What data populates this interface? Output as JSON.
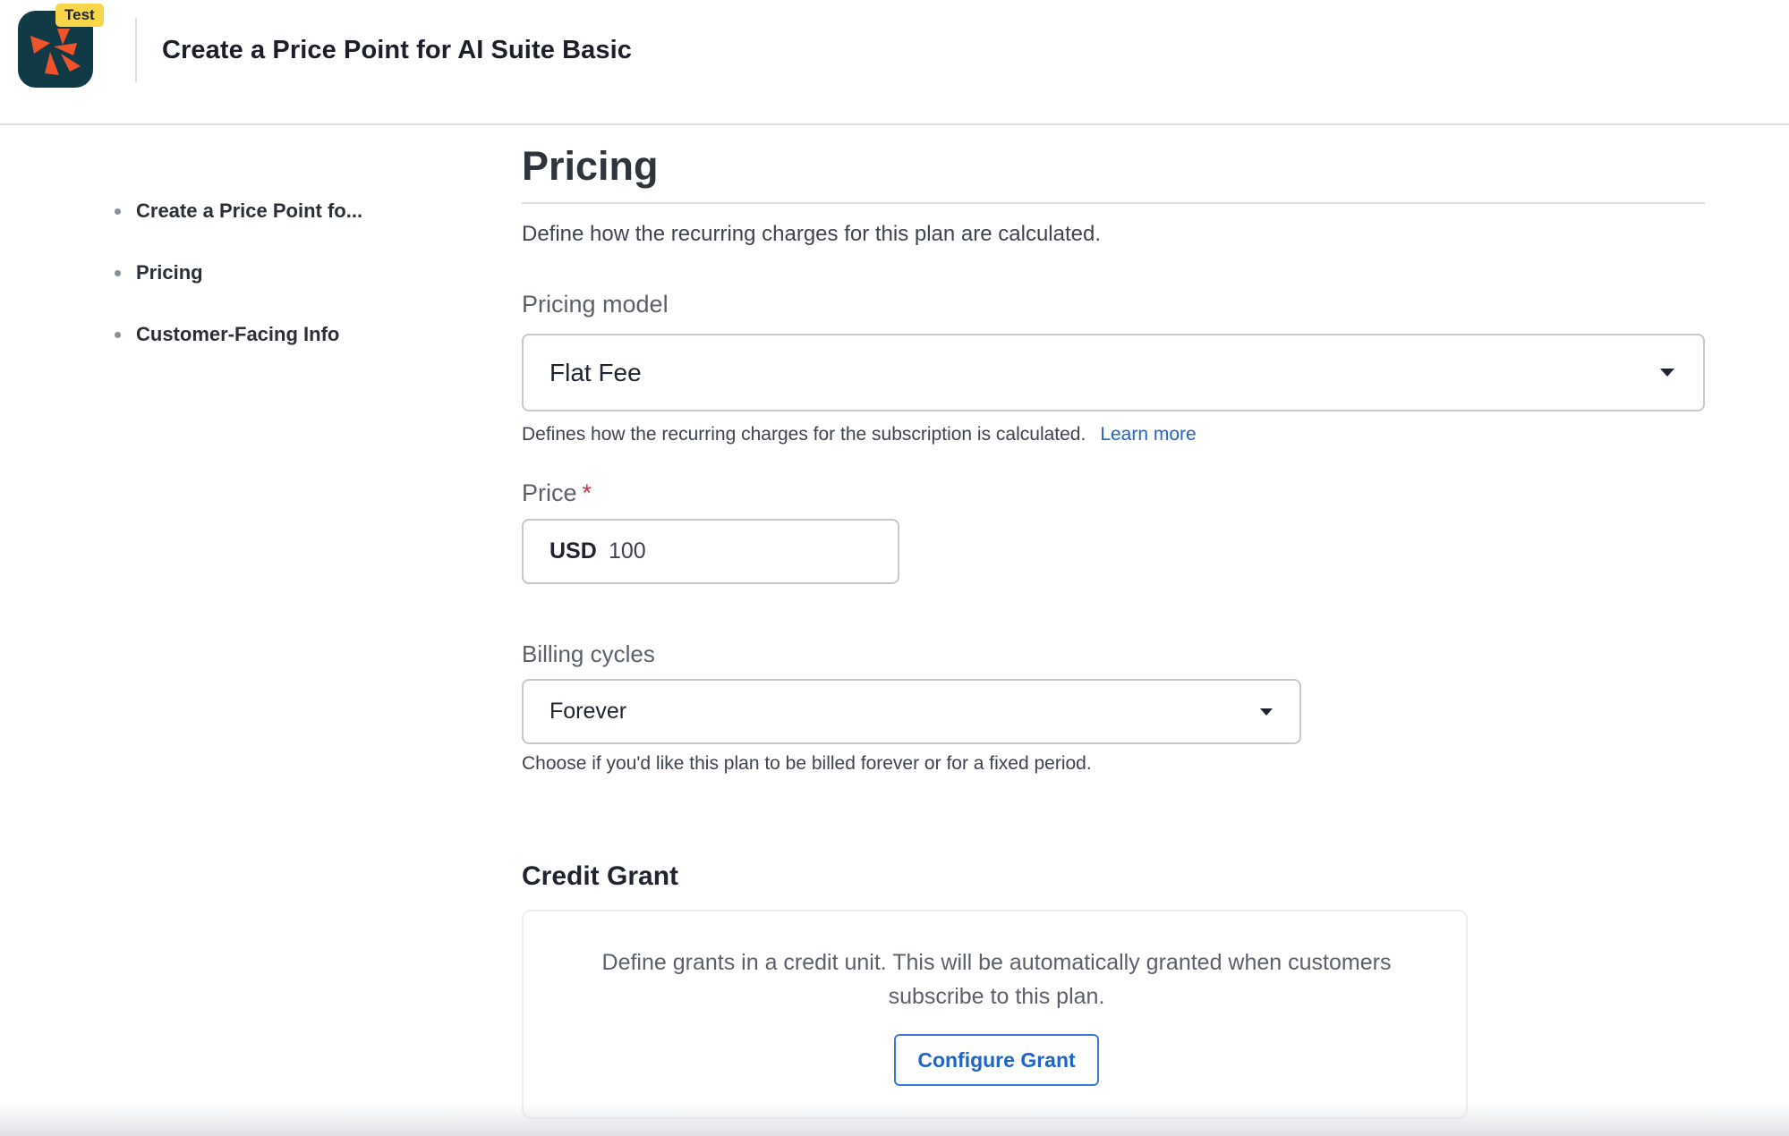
{
  "header": {
    "env_badge": "Test",
    "title": "Create a Price Point for AI Suite Basic"
  },
  "sidebar": {
    "items": [
      {
        "label": "Create a Price Point fo..."
      },
      {
        "label": "Pricing"
      },
      {
        "label": "Customer-Facing Info"
      }
    ]
  },
  "pricing": {
    "title": "Pricing",
    "description": "Define how the recurring charges for this plan are calculated.",
    "model": {
      "label": "Pricing model",
      "value": "Flat Fee",
      "help": "Defines how the recurring charges for the subscription is calculated.",
      "help_link": "Learn more"
    },
    "price": {
      "label": "Price",
      "required_mark": "*",
      "currency": "USD",
      "value": "100"
    },
    "billing": {
      "label": "Billing cycles",
      "value": "Forever",
      "help": "Choose if you'd like this plan to be billed forever or for a fixed period."
    },
    "credit_grant": {
      "title": "Credit Grant",
      "description": "Define grants in a credit unit. This will be automatically granted when customers subscribe to this plan.",
      "button": "Configure Grant"
    }
  },
  "colors": {
    "logo_bg": "#0f3a46",
    "logo_mark": "#f0532a",
    "badge": "#f7d64a",
    "link": "#1f64c8",
    "required": "#d6323a"
  },
  "icons": {
    "logo": "chargebee-logo-icon",
    "dropdown": "chevron-down-icon"
  }
}
